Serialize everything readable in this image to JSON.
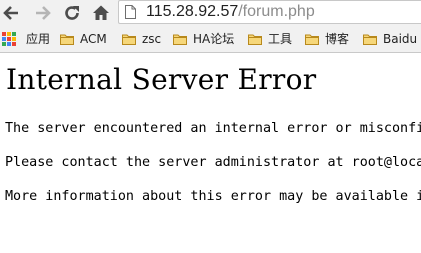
{
  "toolbar": {
    "url_host": "115.28.92.57",
    "url_path": "/forum.php"
  },
  "bookmarks": {
    "apps_label": "应用",
    "items": [
      {
        "label": "ACM"
      },
      {
        "label": "zsc"
      },
      {
        "label": "HA论坛"
      },
      {
        "label": "工具"
      },
      {
        "label": "博客"
      },
      {
        "label": "Baidu"
      }
    ]
  },
  "page": {
    "title": "Internal Server Error",
    "line1": "The server encountered an internal error or misconfiguration and was unable to complete your request.",
    "line2": "Please contact the server administrator at root@localhost to inform them of the time this error occurred, and the actions you performed just before this error.",
    "line3": "More information about this error may be available in the server error log."
  },
  "colors": {
    "folder": "#e5b94a",
    "apps_grid": [
      "#e94235",
      "#fbbc05",
      "#34a853",
      "#4285f4",
      "#e94235",
      "#fbbc05",
      "#34a853",
      "#4285f4",
      "#e94235"
    ]
  }
}
